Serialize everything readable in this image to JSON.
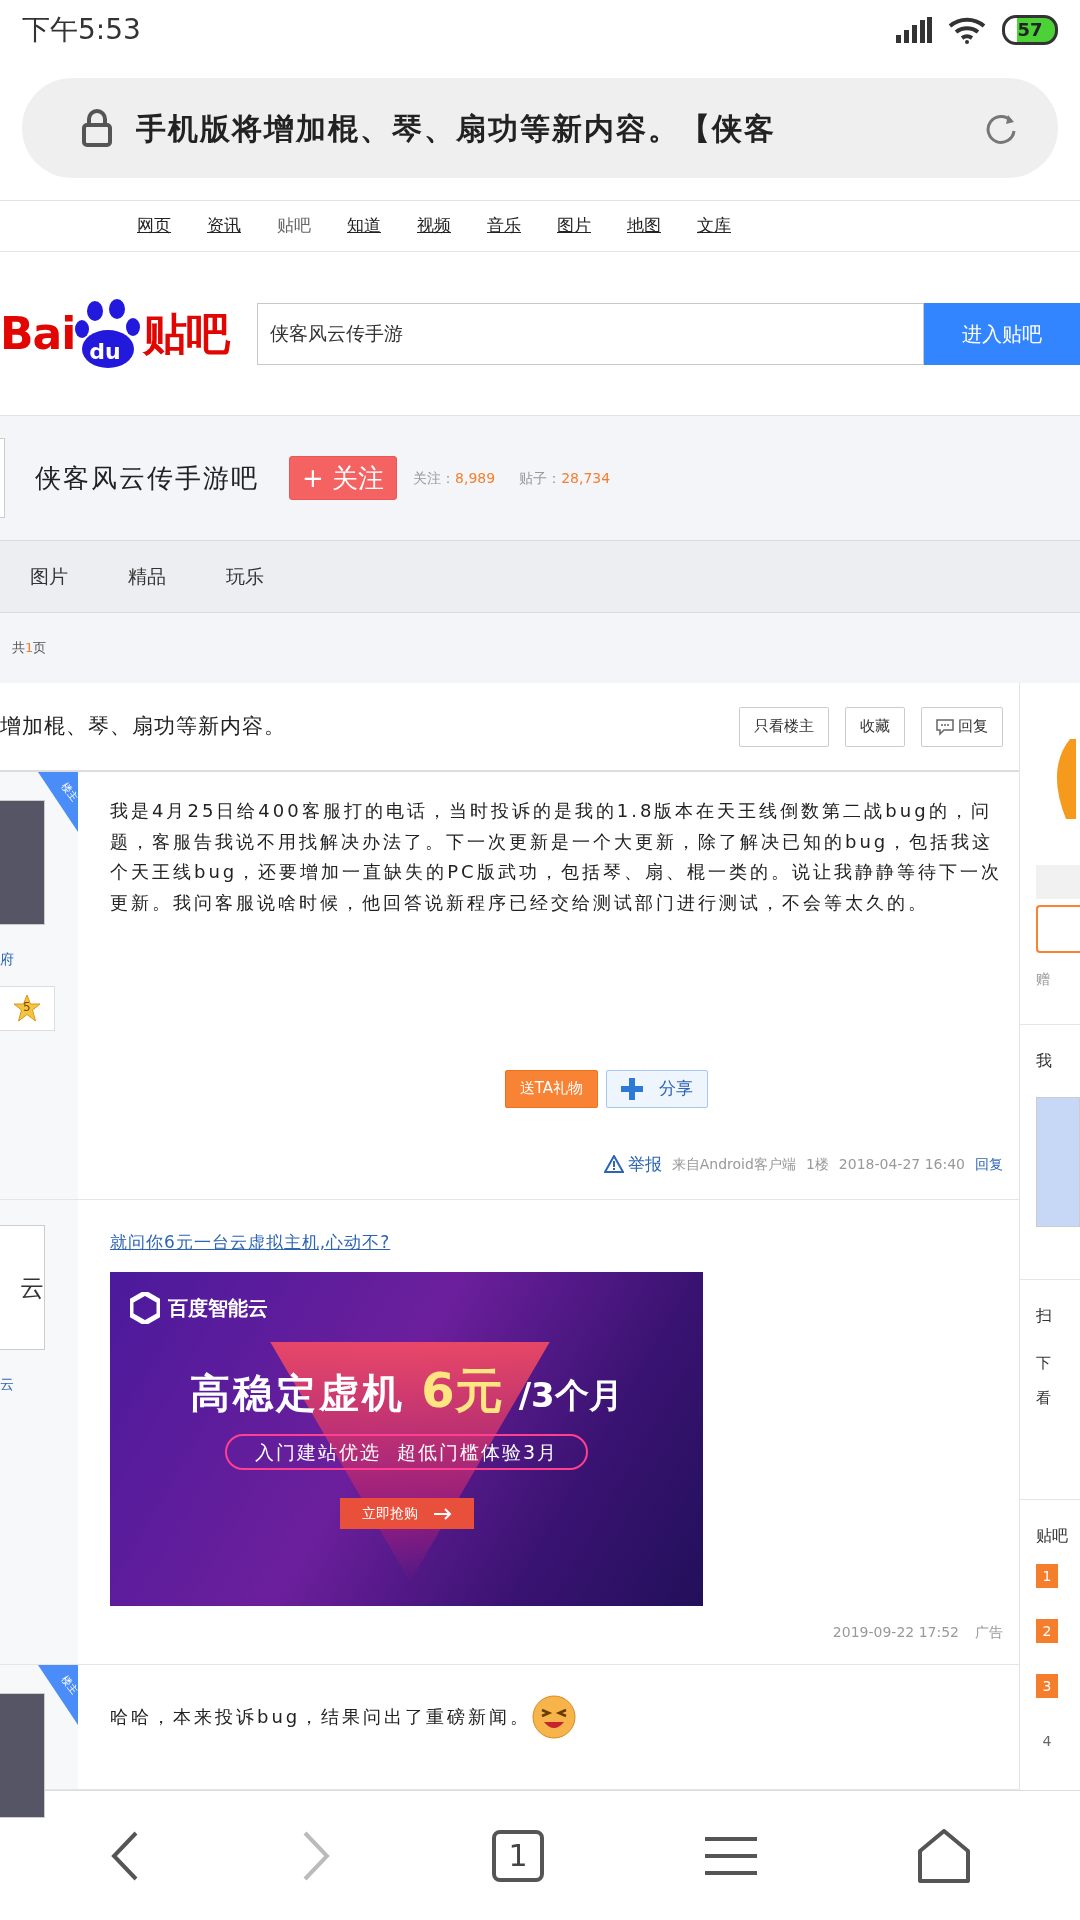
{
  "status_bar": {
    "time": "下午5:53",
    "battery": "57"
  },
  "address_bar": {
    "title": "手机版将增加棍、琴、扇功等新内容。【侠客"
  },
  "search_nav": [
    {
      "label": "网页",
      "selected": false
    },
    {
      "label": "资讯",
      "selected": false
    },
    {
      "label": "贴吧",
      "selected": true
    },
    {
      "label": "知道",
      "selected": false
    },
    {
      "label": "视频",
      "selected": false
    },
    {
      "label": "音乐",
      "selected": false
    },
    {
      "label": "图片",
      "selected": false
    },
    {
      "label": "地图",
      "selected": false
    },
    {
      "label": "文库",
      "selected": false
    }
  ],
  "logo": {
    "left": "Bai",
    "paw": "du",
    "right": "贴吧"
  },
  "search": {
    "value": "侠客风云传手游",
    "button": "进入贴吧"
  },
  "forum": {
    "name": "侠客风云传手游吧",
    "follow_button": "+ 关注",
    "followers_label": "关注：",
    "followers": "8,989",
    "posts_label": "贴子：",
    "posts": "28,734"
  },
  "forum_tabs": [
    "图片",
    "精品",
    "玩乐"
  ],
  "pager": {
    "prefix": "共",
    "count": "1",
    "suffix": "页"
  },
  "thread": {
    "title": "增加棍、琴、扇功等新内容。",
    "actions": [
      {
        "label": "只看楼主",
        "kind": "text"
      },
      {
        "label": "收藏",
        "kind": "text"
      },
      {
        "label": "回复",
        "kind": "reply"
      }
    ]
  },
  "posts": [
    {
      "kind": "post",
      "op_badge": "楼主",
      "username": "府",
      "level": "5",
      "content": "我是4月25日给400客服打的电话，当时投诉的是我的1.8版本在天王线倒数第二战bug的，问题，客服告我说不用找解决办法了。下一次更新是一个大更新，除了解决已知的bug，包括我这个天王线bug，还要增加一直缺失的PC版武功，包括琴、扇、棍一类的。说让我静静等待下一次更新。我问客服说啥时候，他回答说新程序已经交给测试部门进行测试，不会等太久的。",
      "gift_button": "送TA礼物",
      "share_button": "分享",
      "footer": {
        "report": "举报",
        "source": "来自Android客户端",
        "floor": "1楼",
        "time": "2018-04-27 16:40",
        "reply": "回复"
      }
    },
    {
      "kind": "ad",
      "avatar_text": "云",
      "username": "云",
      "title": "就问你6元一台云虚拟主机,心动不?",
      "banner": {
        "brand": "百度智能云",
        "headline": "高稳定虚机",
        "price": "6元",
        "period": "/3个月",
        "subline": "入门建站优选  超低门槛体验3月",
        "cta": "立即抢购"
      },
      "time": "2019-09-22 17:52",
      "label": "广告"
    },
    {
      "kind": "post",
      "op_badge": "楼主",
      "content": "哈哈，本来投诉bug，结果问出了重磅新闻。"
    }
  ],
  "sidebar": {
    "gift_note": "赠",
    "my_heading": "我",
    "scan_heading": "扫",
    "scan_lines": [
      "下",
      "看"
    ],
    "rank_heading": "贴吧",
    "ranks": [
      {
        "number": "1",
        "hot": true
      },
      {
        "number": "2",
        "hot": true
      },
      {
        "number": "3",
        "hot": true
      },
      {
        "number": "4",
        "hot": false
      }
    ]
  },
  "bottom_nav": {
    "tab_count": "1"
  }
}
